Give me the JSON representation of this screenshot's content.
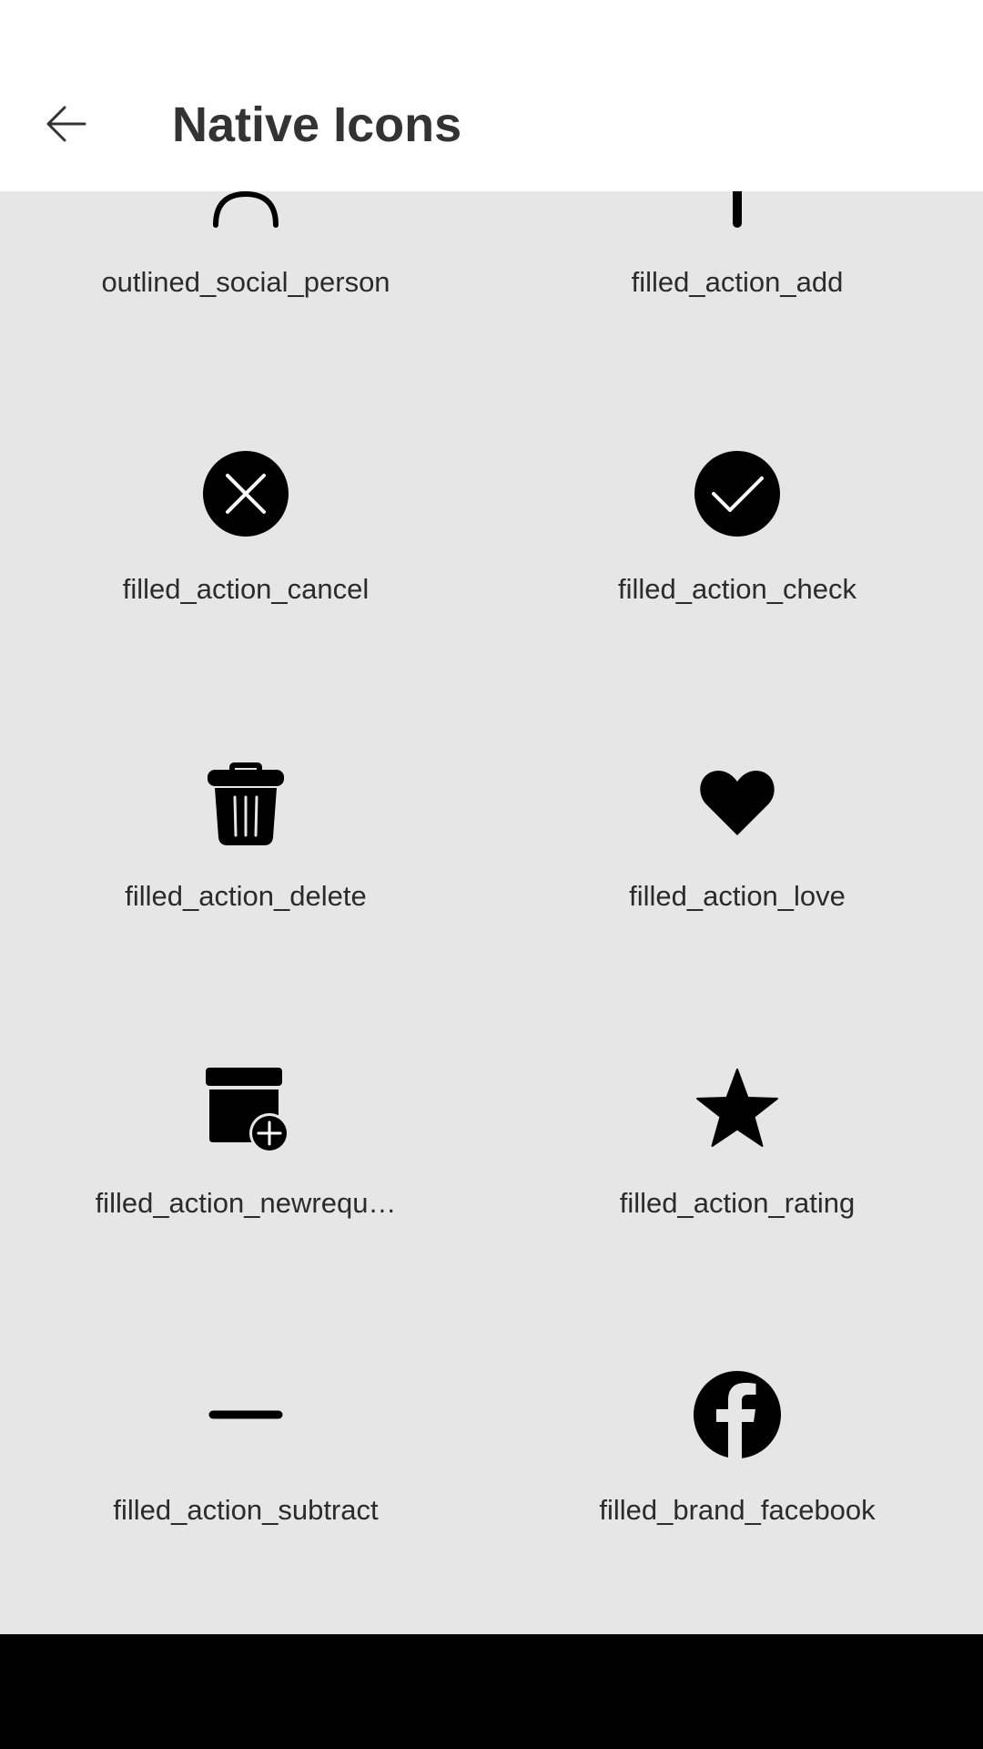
{
  "header": {
    "title": "Native Icons",
    "back_icon": "arrow-left-icon"
  },
  "icons": [
    {
      "label": "outlined_social_person",
      "icon": "person-outline-icon"
    },
    {
      "label": "filled_action_add",
      "icon": "add-icon"
    },
    {
      "label": "filled_action_cancel",
      "icon": "cancel-circle-icon"
    },
    {
      "label": "filled_action_check",
      "icon": "check-circle-icon"
    },
    {
      "label": "filled_action_delete",
      "icon": "trash-icon"
    },
    {
      "label": "filled_action_love",
      "icon": "heart-icon"
    },
    {
      "label": "filled_action_newrequ…",
      "icon": "new-request-icon"
    },
    {
      "label": "filled_action_rating",
      "icon": "star-icon"
    },
    {
      "label": "filled_action_subtract",
      "icon": "minus-icon"
    },
    {
      "label": "filled_brand_facebook",
      "icon": "facebook-icon"
    }
  ],
  "colors": {
    "app_bar": "#ffffff",
    "background": "#e6e6e6",
    "icon": "#000000",
    "nav_bar": "#000000"
  }
}
